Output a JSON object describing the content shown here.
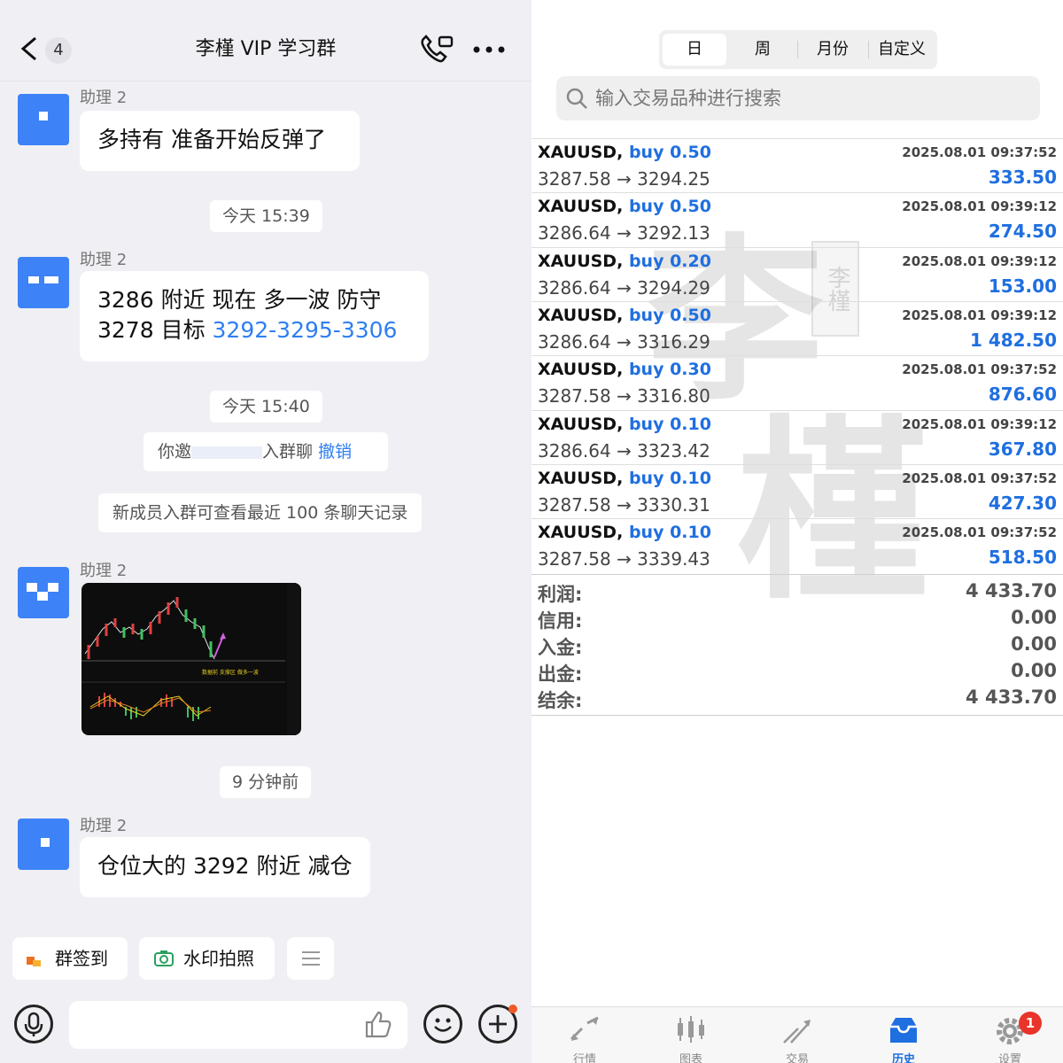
{
  "chat": {
    "header": {
      "back_count": "4",
      "title": "李槿 VIP 学习群"
    },
    "messages": [
      {
        "sender": "助理 2",
        "text": "多持有  准备开始反弹了"
      },
      {
        "time": "今天 15:39"
      },
      {
        "sender": "助理 2",
        "text_line1": "3286 附近 现在 多一波  防守",
        "text_line2_prefix": "3278   目标 ",
        "text_line2_link": "3292-3295-3306"
      },
      {
        "time": "今天 15:40"
      },
      {
        "system_prefix": "你邀",
        "system_suffix": "入群聊",
        "system_action": "撤销"
      },
      {
        "system": "新成员入群可查看最近 100 条聊天记录"
      },
      {
        "sender": "助理 2",
        "image_caption": "数据前 支撑区 做多一波"
      },
      {
        "time": "9 分钟前"
      },
      {
        "sender": "助理 2",
        "text": "仓位大的 3292 附近 减仓"
      }
    ],
    "quick_actions": {
      "checkin": "群签到",
      "watermark_photo": "水印拍照"
    }
  },
  "history": {
    "period_tabs": [
      "日",
      "周",
      "月份",
      "自定义"
    ],
    "active_tab": "日",
    "search_placeholder": "输入交易品种进行搜索",
    "trades": [
      {
        "symbol": "XAUUSD,",
        "side": "buy 0.50",
        "time": "2025.08.01 09:37:52",
        "prices": "3287.58 → 3294.25",
        "profit": "333.50"
      },
      {
        "symbol": "XAUUSD,",
        "side": "buy 0.50",
        "time": "2025.08.01 09:39:12",
        "prices": "3286.64 → 3292.13",
        "profit": "274.50"
      },
      {
        "symbol": "XAUUSD,",
        "side": "buy 0.20",
        "time": "2025.08.01 09:39:12",
        "prices": "3286.64 → 3294.29",
        "profit": "153.00"
      },
      {
        "symbol": "XAUUSD,",
        "side": "buy 0.50",
        "time": "2025.08.01 09:39:12",
        "prices": "3286.64 → 3316.29",
        "profit": "1 482.50"
      },
      {
        "symbol": "XAUUSD,",
        "side": "buy 0.30",
        "time": "2025.08.01 09:37:52",
        "prices": "3287.58 → 3316.80",
        "profit": "876.60"
      },
      {
        "symbol": "XAUUSD,",
        "side": "buy 0.10",
        "time": "2025.08.01 09:39:12",
        "prices": "3286.64 → 3323.42",
        "profit": "367.80"
      },
      {
        "symbol": "XAUUSD,",
        "side": "buy 0.10",
        "time": "2025.08.01 09:37:52",
        "prices": "3287.58 → 3330.31",
        "profit": "427.30"
      },
      {
        "symbol": "XAUUSD,",
        "side": "buy 0.10",
        "time": "2025.08.01 09:37:52",
        "prices": "3287.58 → 3339.43",
        "profit": "518.50"
      }
    ],
    "summary": [
      {
        "label": "利润:",
        "value": "4 433.70"
      },
      {
        "label": "信用:",
        "value": "0.00"
      },
      {
        "label": "入金:",
        "value": "0.00"
      },
      {
        "label": "出金:",
        "value": "0.00"
      },
      {
        "label": "结余:",
        "value": "4 433.70"
      }
    ],
    "tabbar": [
      {
        "label": "行情",
        "icon": "quotes-icon"
      },
      {
        "label": "图表",
        "icon": "chart-icon"
      },
      {
        "label": "交易",
        "icon": "trade-icon"
      },
      {
        "label": "历史",
        "icon": "history-icon"
      },
      {
        "label": "设置",
        "icon": "settings-icon"
      }
    ],
    "active_bottom_tab": "历史",
    "settings_badge": "1",
    "watermark": "李槿",
    "watermark_seal": "李槿"
  },
  "colors": {
    "accent_blue": "#1f6fe0",
    "chat_link": "#2f7ff0",
    "avatar_blue": "#3d82f7",
    "badge_red": "#e8342a"
  }
}
